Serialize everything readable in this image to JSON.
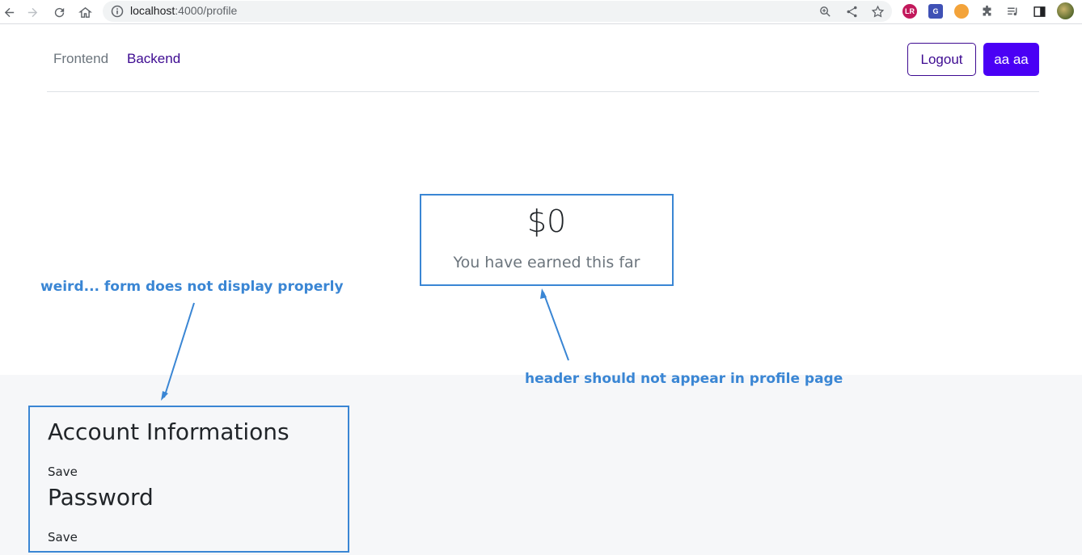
{
  "browser": {
    "url_host": "localhost",
    "url_path": ":4000/profile"
  },
  "header": {
    "nav": [
      {
        "label": "Frontend"
      },
      {
        "label": "Backend"
      }
    ],
    "logout_label": "Logout",
    "user_label": "aa aa"
  },
  "earnings": {
    "amount": "$0",
    "caption": "You have earned this far"
  },
  "account": {
    "info_heading": "Account Informations",
    "info_save": "Save",
    "password_heading": "Password",
    "password_save": "Save"
  },
  "annotations": {
    "form_note": "weird... form does not display properly",
    "header_note": "header should not appear in profile page"
  },
  "colors": {
    "accent": "#4a00f5",
    "link": "#3d0a91",
    "annotation": "#3a86d4"
  }
}
